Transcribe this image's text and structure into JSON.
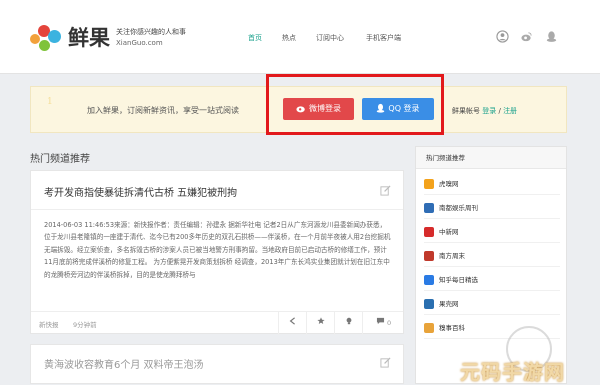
{
  "brand": {
    "name": "鲜果",
    "slogan": "关注你感兴趣的人和事",
    "domain": "XianGuo.com"
  },
  "nav": {
    "items": [
      "首页",
      "热点",
      "订阅中心",
      "手机客户端"
    ],
    "active": 0
  },
  "banner": {
    "number": "1",
    "message": "加入鲜果，订阅新鲜资讯，享受一站式阅读",
    "weibo_login": "微博登录",
    "qq_login": "QQ 登录",
    "account_label": "鲜果帐号",
    "login": "登录",
    "slash": "/",
    "register": "注册"
  },
  "section": {
    "title": "热门频道推荐"
  },
  "card1": {
    "title": "考开发商指使暴徒拆清代古桥 五嫌犯被刑拘",
    "body": "2014-06-03 11:46:53来源：新快报作者：责任编辑：孙建永 据新华社电 记者2日从广东河源龙川县委新闻办获悉，位于龙川县老隆镇的一座建于清代、迄今已有200多年历史的双孔石拱桥——伴溪桥，在一个月前半夜被人用2台挖掘机无端拆毁。经立案侦查，多名拆毁古桥的涉案人员已被当地警方刑事拘留。当地政府目前已启动古桥的修缮工作，预计11月底前将完成伴溪桥的修复工程。 为方便紫晃开发商策划拆桥 经调查，2013年广东长鸿实业集团就计划在旧江东中的龙腾桥旁河边的伴溪桥拆掉，目的是使龙腾拜桥与",
    "tag": "新快报",
    "time": "9分钟前",
    "comments": "0"
  },
  "card2": {
    "title": "黄海波收容教育6个月 双料帝王泡汤"
  },
  "sidebar": {
    "title": "热门频道推荐",
    "items": [
      {
        "label": "虎嗅网",
        "color": "#f3a21b"
      },
      {
        "label": "南都娱乐周刊",
        "color": "#2f6db5"
      },
      {
        "label": "中新网",
        "color": "#d62b2b"
      },
      {
        "label": "南方周末",
        "color": "#c0392b"
      },
      {
        "label": "知乎每日精选",
        "color": "#2a7be4"
      },
      {
        "label": "果壳网",
        "color": "#2a6fb0"
      },
      {
        "label": "糗事百科",
        "color": "#e8a33a"
      }
    ]
  },
  "watermark": {
    "text": "元码手游网"
  }
}
